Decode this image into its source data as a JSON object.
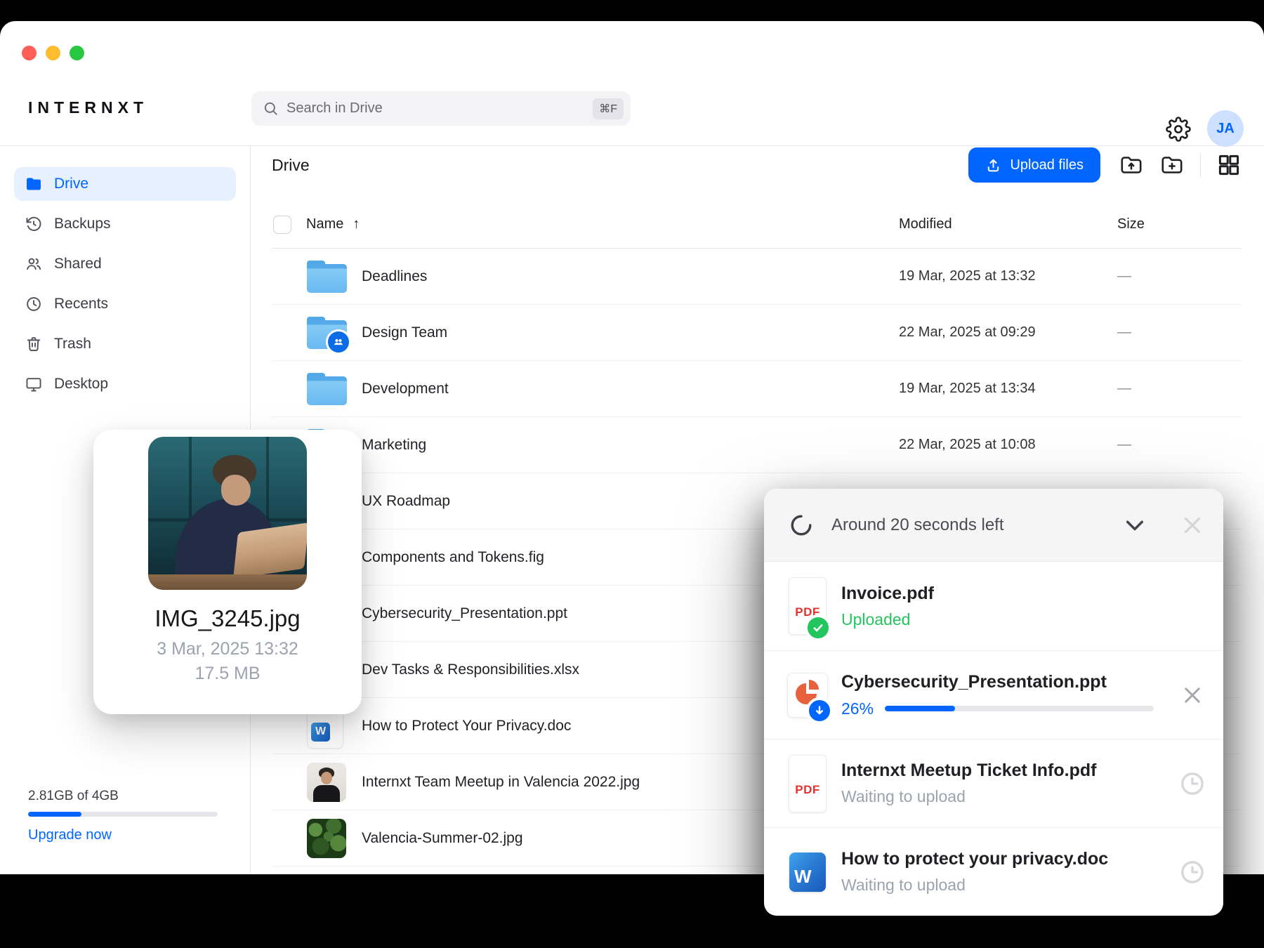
{
  "colors": {
    "accent": "#0066FF",
    "success_green": "#22C55E",
    "pdf_red": "#E5322D",
    "ppt_orange": "#E8613F",
    "word_blue": "#185ABD",
    "folder_blue": "#68B8F1"
  },
  "icon_labels": {
    "pdf": "PDF",
    "word": "W"
  },
  "topbar": {
    "logo": "INTERNXT",
    "search_placeholder": "Search in Drive",
    "search_shortcut": "⌘F",
    "avatar_initials": "JA"
  },
  "sidebar": {
    "items": [
      {
        "id": "drive",
        "label": "Drive",
        "active": true
      },
      {
        "id": "backups",
        "label": "Backups",
        "active": false
      },
      {
        "id": "shared",
        "label": "Shared",
        "active": false
      },
      {
        "id": "recents",
        "label": "Recents",
        "active": false
      },
      {
        "id": "trash",
        "label": "Trash",
        "active": false
      },
      {
        "id": "desktop",
        "label": "Desktop",
        "active": false
      }
    ],
    "usage": {
      "label": "2.81GB of 4GB",
      "percent_used": 28,
      "upgrade_label": "Upgrade now"
    }
  },
  "main": {
    "title": "Drive",
    "upload_button_label": "Upload files",
    "columns": {
      "name": "Name",
      "sort_indicator": "↑",
      "modified": "Modified",
      "size": "Size"
    },
    "rows": [
      {
        "name": "Deadlines",
        "type": "folder",
        "shared": false,
        "modified": "19 Mar, 2025 at 13:32",
        "size": "—"
      },
      {
        "name": "Design Team",
        "type": "folder",
        "shared": true,
        "modified": "22 Mar, 2025 at 09:29",
        "size": "—"
      },
      {
        "name": "Development",
        "type": "folder",
        "shared": false,
        "modified": "19 Mar, 2025 at 13:34",
        "size": "—"
      },
      {
        "name": "Marketing",
        "type": "folder",
        "shared": false,
        "modified": "22 Mar, 2025 at 10:08",
        "size": "—"
      },
      {
        "name": "UX Roadmap",
        "type": "folder",
        "shared": false,
        "modified": "",
        "size": ""
      },
      {
        "name": "Components and Tokens.fig",
        "type": "file",
        "modified": "",
        "size": ""
      },
      {
        "name": "Cybersecurity_Presentation.ppt",
        "type": "file",
        "modified": "",
        "size": ""
      },
      {
        "name": "Dev Tasks & Responsibilities.xlsx",
        "type": "file",
        "modified": "",
        "size": ""
      },
      {
        "name": "How to Protect Your Privacy.doc",
        "type": "word",
        "modified": "",
        "size": ""
      },
      {
        "name": "Internxt Team Meetup in Valencia 2022.jpg",
        "type": "image-portrait",
        "modified": "",
        "size": ""
      },
      {
        "name": "Valencia-Summer-02.jpg",
        "type": "image-leaves",
        "modified": "",
        "size": ""
      }
    ]
  },
  "preview_card": {
    "filename": "IMG_3245.jpg",
    "modified": "3 Mar, 2025 13:32",
    "filesize": "17.5 MB"
  },
  "upload_toast": {
    "title": "Around 20 seconds left",
    "items": [
      {
        "filename": "Invoice.pdf",
        "status": "Uploaded",
        "kind": "pdf",
        "state": "done"
      },
      {
        "filename": "Cybersecurity_Presentation.ppt",
        "status": "26%",
        "percent": 26,
        "kind": "ppt",
        "state": "uploading"
      },
      {
        "filename": "Internxt Meetup Ticket Info.pdf",
        "status": "Waiting to upload",
        "kind": "pdf",
        "state": "waiting"
      },
      {
        "filename": "How to protect your privacy.doc",
        "status": "Waiting to upload",
        "kind": "word",
        "state": "waiting"
      }
    ]
  }
}
